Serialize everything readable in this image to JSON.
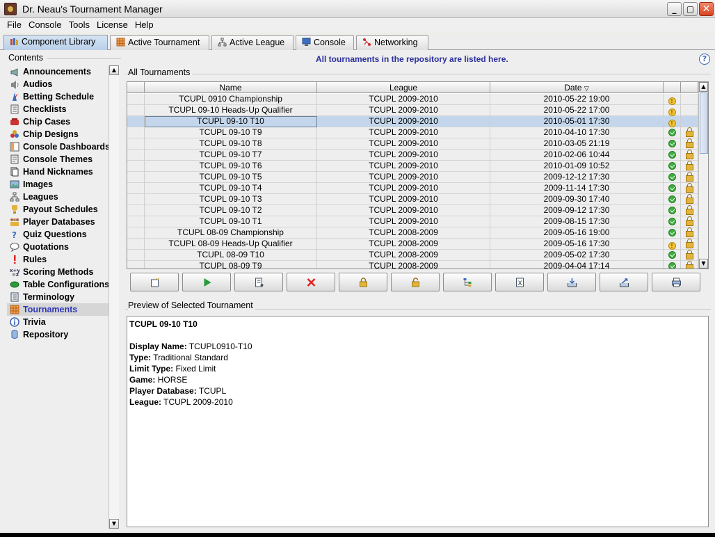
{
  "window": {
    "title": "Dr. Neau's Tournament Manager"
  },
  "menu": [
    "File",
    "Console",
    "Tools",
    "License",
    "Help"
  ],
  "tabs": [
    {
      "label": "Component Library",
      "icon": "books-icon",
      "active": true
    },
    {
      "label": "Active Tournament",
      "icon": "grid-icon"
    },
    {
      "label": "Active League",
      "icon": "hierarchy-icon"
    },
    {
      "label": "Console",
      "icon": "monitor-icon"
    },
    {
      "label": "Networking",
      "icon": "network-icon"
    }
  ],
  "sidebar": {
    "title": "Contents",
    "items": [
      {
        "label": "Announcements",
        "icon": "megaphone-icon"
      },
      {
        "label": "Audios",
        "icon": "speaker-icon"
      },
      {
        "label": "Betting Schedule",
        "icon": "metronome-icon"
      },
      {
        "label": "Checklists",
        "icon": "checklist-icon"
      },
      {
        "label": "Chip Cases",
        "icon": "chip-case-icon"
      },
      {
        "label": "Chip Designs",
        "icon": "chips-icon"
      },
      {
        "label": "Console Dashboards",
        "icon": "dashboard-icon"
      },
      {
        "label": "Console Themes",
        "icon": "theme-icon"
      },
      {
        "label": "Hand Nicknames",
        "icon": "cards-icon"
      },
      {
        "label": "Images",
        "icon": "image-icon"
      },
      {
        "label": "Leagues",
        "icon": "hierarchy-icon"
      },
      {
        "label": "Payout Schedules",
        "icon": "trophy-icon"
      },
      {
        "label": "Player Databases",
        "icon": "players-icon"
      },
      {
        "label": "Quiz Questions",
        "icon": "question-icon"
      },
      {
        "label": "Quotations",
        "icon": "speech-bubble-icon"
      },
      {
        "label": "Rules",
        "icon": "exclamation-icon"
      },
      {
        "label": "Scoring Methods",
        "icon": "xy-icon"
      },
      {
        "label": "Table Configurations",
        "icon": "table-icon"
      },
      {
        "label": "Terminology",
        "icon": "book-icon"
      },
      {
        "label": "Tournaments",
        "icon": "grid-icon",
        "selected": true
      },
      {
        "label": "Trivia",
        "icon": "info-icon"
      },
      {
        "label": "Repository",
        "icon": "database-icon"
      }
    ]
  },
  "main": {
    "info_text": "All tournaments in the repository are listed here.",
    "list_title": "All Tournaments",
    "columns": [
      "Name",
      "League",
      "Date"
    ],
    "sort_indicator": "▽",
    "rows": [
      {
        "name": "TCUPL 0910 Championship",
        "league": "TCUPL 2009-2010",
        "date": "2010-05-22 19:00",
        "status": "warning",
        "locked": false
      },
      {
        "name": "TCUPL 09-10 Heads-Up Qualifier",
        "league": "TCUPL 2009-2010",
        "date": "2010-05-22 17:00",
        "status": "warning",
        "locked": false
      },
      {
        "name": "TCUPL 09-10 T10",
        "league": "TCUPL 2009-2010",
        "date": "2010-05-01 17:30",
        "status": "warning",
        "locked": false,
        "selected": true
      },
      {
        "name": "TCUPL 09-10 T9",
        "league": "TCUPL 2009-2010",
        "date": "2010-04-10 17:30",
        "status": "ok",
        "locked": true
      },
      {
        "name": "TCUPL 09-10 T8",
        "league": "TCUPL 2009-2010",
        "date": "2010-03-05 21:19",
        "status": "ok",
        "locked": true
      },
      {
        "name": "TCUPL 09-10 T7",
        "league": "TCUPL 2009-2010",
        "date": "2010-02-06 10:44",
        "status": "ok",
        "locked": true
      },
      {
        "name": "TCUPL 09-10 T6",
        "league": "TCUPL 2009-2010",
        "date": "2010-01-09 10:52",
        "status": "ok",
        "locked": true
      },
      {
        "name": "TCUPL 09-10 T5",
        "league": "TCUPL 2009-2010",
        "date": "2009-12-12 17:30",
        "status": "ok",
        "locked": true
      },
      {
        "name": "TCUPL 09-10 T4",
        "league": "TCUPL 2009-2010",
        "date": "2009-11-14 17:30",
        "status": "ok",
        "locked": true
      },
      {
        "name": "TCUPL 09-10 T3",
        "league": "TCUPL 2009-2010",
        "date": "2009-09-30 17:40",
        "status": "ok",
        "locked": true
      },
      {
        "name": "TCUPL 09-10 T2",
        "league": "TCUPL 2009-2010",
        "date": "2009-09-12 17:30",
        "status": "ok",
        "locked": true
      },
      {
        "name": "TCUPL 09-10 T1",
        "league": "TCUPL 2009-2010",
        "date": "2009-08-15 17:30",
        "status": "ok",
        "locked": true
      },
      {
        "name": "TCUPL 08-09 Championship",
        "league": "TCUPL 2008-2009",
        "date": "2009-05-16 19:00",
        "status": "ok",
        "locked": true
      },
      {
        "name": "TCUPL 08-09 Heads-Up Qualifier",
        "league": "TCUPL 2008-2009",
        "date": "2009-05-16 17:30",
        "status": "warning",
        "locked": true
      },
      {
        "name": "TCUPL 08-09 T10",
        "league": "TCUPL 2008-2009",
        "date": "2009-05-02 17:30",
        "status": "ok",
        "locked": true
      },
      {
        "name": "TCUPL 08-09 T9",
        "league": "TCUPL 2008-2009",
        "date": "2009-04-04 17:14",
        "status": "ok",
        "locked": true
      }
    ],
    "toolbar": [
      {
        "name": "new-button",
        "icon": "new-document-icon"
      },
      {
        "name": "play-button",
        "icon": "play-icon"
      },
      {
        "name": "edit-button",
        "icon": "edit-document-icon"
      },
      {
        "name": "delete-button",
        "icon": "delete-icon"
      },
      {
        "name": "lock-button",
        "icon": "lock-icon"
      },
      {
        "name": "unlock-button",
        "icon": "unlock-icon"
      },
      {
        "name": "tree-button",
        "icon": "tree-icon"
      },
      {
        "name": "export-excel-button",
        "icon": "excel-icon"
      },
      {
        "name": "import-button",
        "icon": "import-tray-icon"
      },
      {
        "name": "export-button",
        "icon": "export-tray-icon"
      },
      {
        "name": "print-button",
        "icon": "printer-icon"
      }
    ],
    "preview_title": "Preview of Selected Tournament",
    "preview": {
      "heading": "TCUPL 09-10 T10",
      "fields": [
        {
          "label": "Display Name:",
          "value": "TCUPL0910-T10"
        },
        {
          "label": "Type:",
          "value": "Traditional Standard"
        },
        {
          "label": "Limit Type:",
          "value": "Fixed Limit"
        },
        {
          "label": "Game:",
          "value": "HORSE"
        },
        {
          "label": "Player Database:",
          "value": "TCUPL"
        },
        {
          "label": "League:",
          "value": "TCUPL 2009-2010"
        }
      ]
    }
  },
  "colors": {
    "accent_text": "#2b2f9d",
    "selected_row": "#c3d6eb",
    "tab_active": "#c6d9ee"
  }
}
